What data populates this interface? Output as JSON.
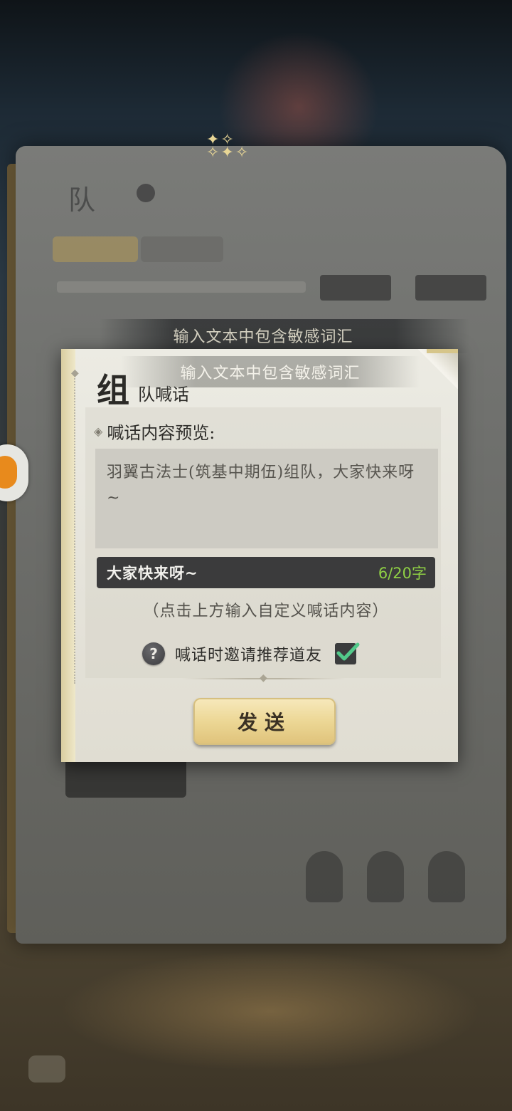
{
  "background": {
    "panel_title": "队",
    "warning_banner": "输入文本中包含敏感词汇"
  },
  "toast": {
    "message": "输入文本中包含敏感词汇"
  },
  "dialog": {
    "title_big": "组",
    "title_small": "队喊话",
    "preview_label": "喊话内容预览:",
    "preview_text": "羽翼古法士(筑基中期伍)组队，大家快来呀~",
    "input_value": "大家快来呀~",
    "char_count": "6/20字",
    "hint": "（点击上方输入自定义喊话内容）",
    "help_icon_glyph": "?",
    "invite_label": "喊话时邀请推荐道友",
    "invite_checked": true,
    "send_label": "发送"
  },
  "colors": {
    "accent_green": "#8fd045",
    "check_green": "#52c98a",
    "button_gold": "#ecd795"
  }
}
